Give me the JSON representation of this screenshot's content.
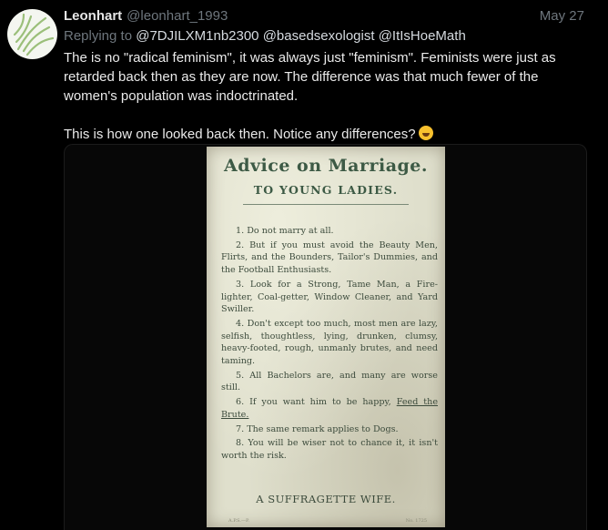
{
  "tweet": {
    "author_name": "Leonhart",
    "author_handle": "@leonhart_1993",
    "date": "May 27",
    "replying_label": "Replying to",
    "replying_to": [
      "@7DJILXM1nb2300",
      "@basedsexologist",
      "@ItIsHoeMath"
    ],
    "paragraph_1": "The is no \"radical feminism\", it was always just \"feminism\". Feminists were just as retarded back then as they are now. The difference was that much fewer of the women's population was indoctrinated.",
    "paragraph_2": "This is how one looked back then. Notice any differences?",
    "emoji": "face-with-tears-of-joy"
  },
  "postcard": {
    "title": "Advice on Marriage.",
    "subtitle": "TO YOUNG LADIES.",
    "items": [
      {
        "num": "1.",
        "text": "Do not marry at all."
      },
      {
        "num": "2.",
        "text": "But if you must avoid the Beauty Men, Flirts, and the Bounders, Tailor's Dummies, and the Football Enthusiasts."
      },
      {
        "num": "3.",
        "text": "Look for a Strong, Tame Man, a Fire-lighter, Coal-getter, Window Cleaner, and Yard Swiller."
      },
      {
        "num": "4.",
        "text": "Don't except too much, most men are lazy, selfish, thoughtless, lying, drunken, clumsy, heavy-footed, rough, unmanly brutes, and need taming."
      },
      {
        "num": "5.",
        "text": "All Bachelors are, and many are worse still."
      },
      {
        "num": "6.",
        "text": "If you want him to be happy,",
        "underlined": "Feed the Brute."
      },
      {
        "num": "7.",
        "text": "The same remark applies to Dogs."
      },
      {
        "num": "8.",
        "text": "You will be wiser not to chance it, it isn't worth the risk."
      }
    ],
    "signature": "A SUFFRAGETTE WIFE.",
    "footer_left": "A.P.S.—P.",
    "footer_right": "No. 1725"
  }
}
